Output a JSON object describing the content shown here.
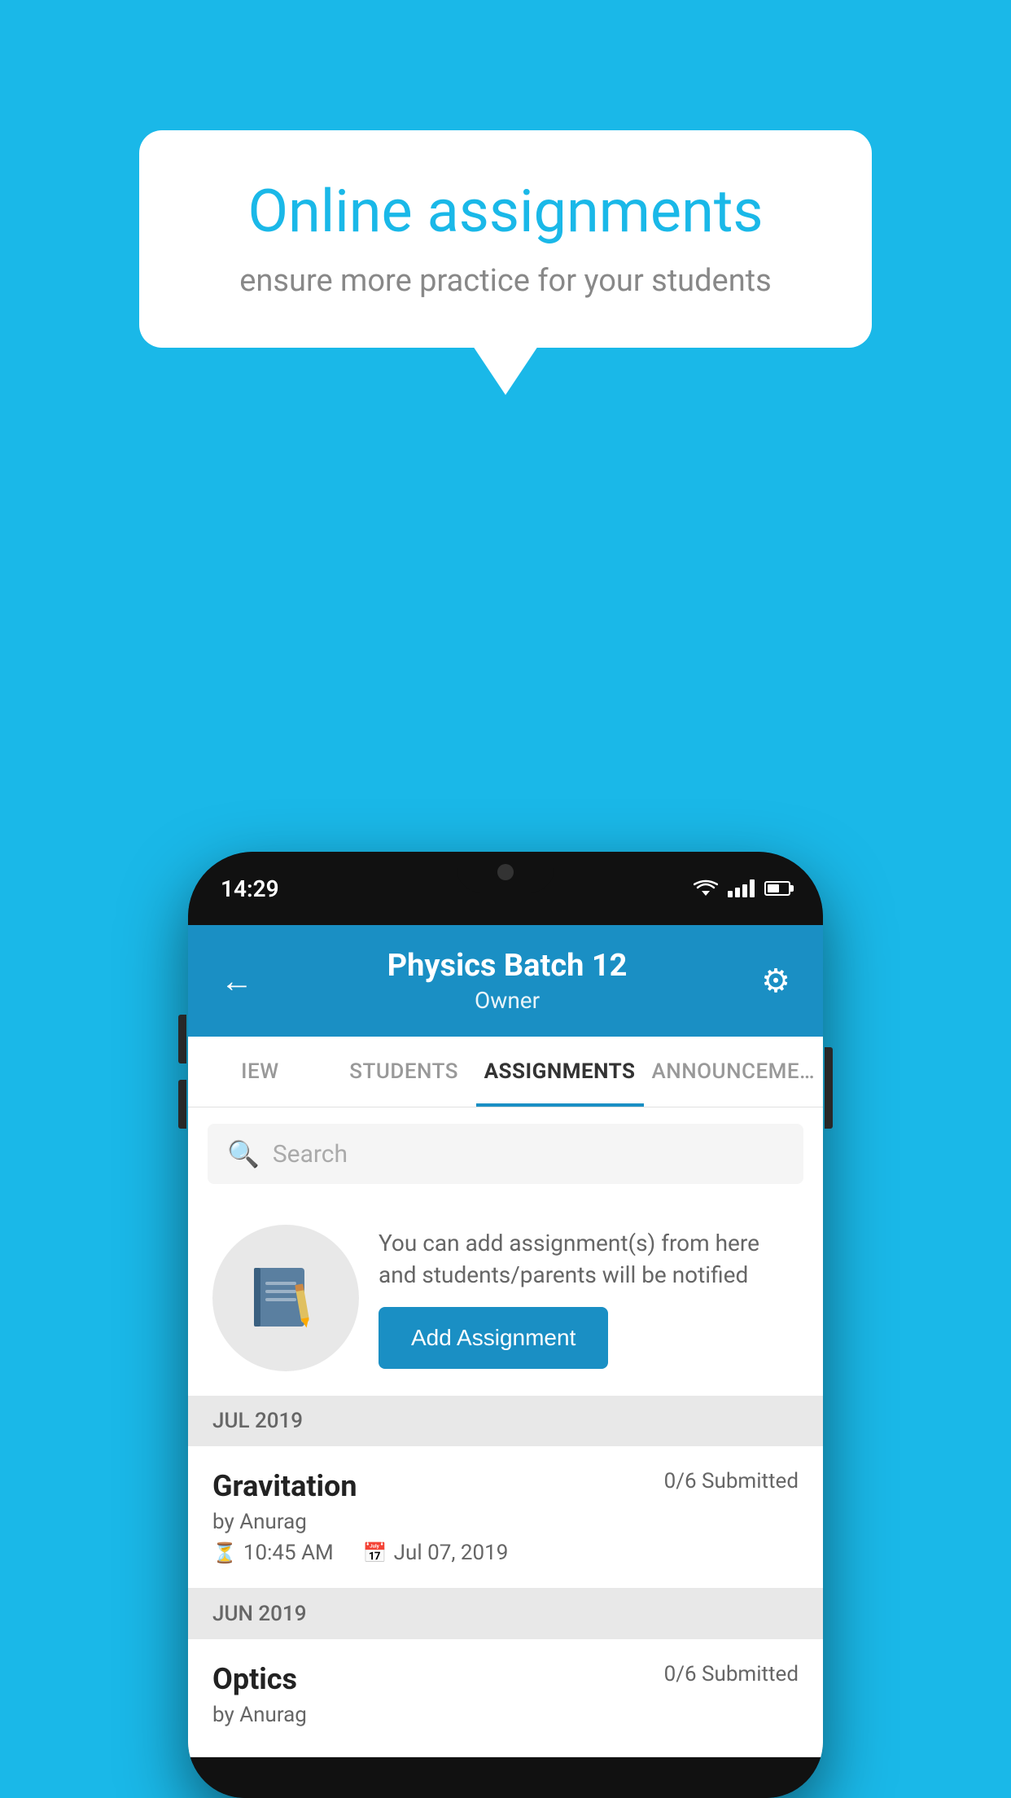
{
  "background_color": "#1ab8e8",
  "bubble": {
    "title": "Online assignments",
    "subtitle": "ensure more practice for your students"
  },
  "phone": {
    "status_time": "14:29",
    "header": {
      "title": "Physics Batch 12",
      "subtitle": "Owner"
    },
    "tabs": [
      {
        "label": "IEW",
        "active": false
      },
      {
        "label": "STUDENTS",
        "active": false
      },
      {
        "label": "ASSIGNMENTS",
        "active": true
      },
      {
        "label": "ANNOUNCEMENTS",
        "active": false
      }
    ],
    "search_placeholder": "Search",
    "promo": {
      "description": "You can add assignment(s) from here and students/parents will be notified",
      "button_label": "Add Assignment"
    },
    "assignments": [
      {
        "month": "JUL 2019",
        "name": "Gravitation",
        "submitted": "0/6 Submitted",
        "by": "by Anurag",
        "time": "10:45 AM",
        "date": "Jul 07, 2019"
      },
      {
        "month": "JUN 2019",
        "name": "Optics",
        "submitted": "0/6 Submitted",
        "by": "by Anurag",
        "time": "",
        "date": ""
      }
    ]
  }
}
